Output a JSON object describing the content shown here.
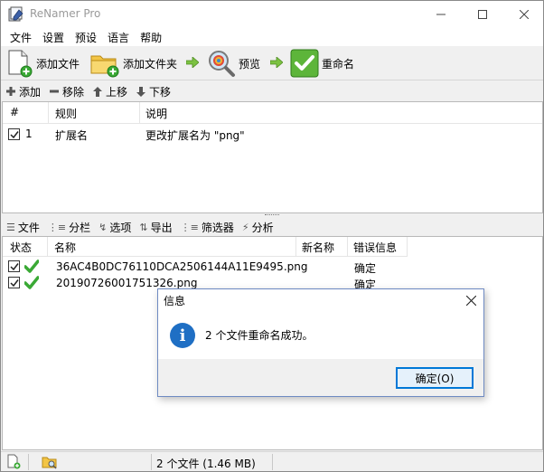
{
  "window": {
    "title": "ReNamer Pro"
  },
  "menu": [
    "文件",
    "设置",
    "预设",
    "语言",
    "帮助"
  ],
  "toolbar": {
    "add_files": "添加文件",
    "add_folder": "添加文件夹",
    "preview": "预览",
    "rename": "重命名"
  },
  "rules_toolbar": {
    "add": "添加",
    "remove": "移除",
    "move_up": "上移",
    "move_down": "下移"
  },
  "rules_table": {
    "headers": [
      "#",
      "规则",
      "说明"
    ],
    "rows": [
      {
        "checked": true,
        "index": "1",
        "rule": "扩展名",
        "description": "更改扩展名为 \"png\""
      }
    ]
  },
  "files_toolbar": [
    "文件",
    "分栏",
    "选项",
    "导出",
    "筛选器",
    "分析"
  ],
  "files_table": {
    "headers": [
      "状态",
      "名称",
      "新名称",
      "错误信息"
    ],
    "rows": [
      {
        "checked": true,
        "status": "ok",
        "name": "36AC4B0DC76110DCA2506144A11E9495.png",
        "new_name": "",
        "error": "确定"
      },
      {
        "checked": true,
        "status": "ok",
        "name": "20190726001751326.png",
        "new_name": "",
        "error": "确定"
      }
    ]
  },
  "statusbar": {
    "summary": "2 个文件 (1.46 MB)"
  },
  "dialog": {
    "title": "信息",
    "message": "2 个文件重命名成功。",
    "ok": "确定(O)"
  },
  "colors": {
    "accent": "#0078d7",
    "info_icon": "#1f6fc4",
    "check_green": "#3aa935"
  }
}
